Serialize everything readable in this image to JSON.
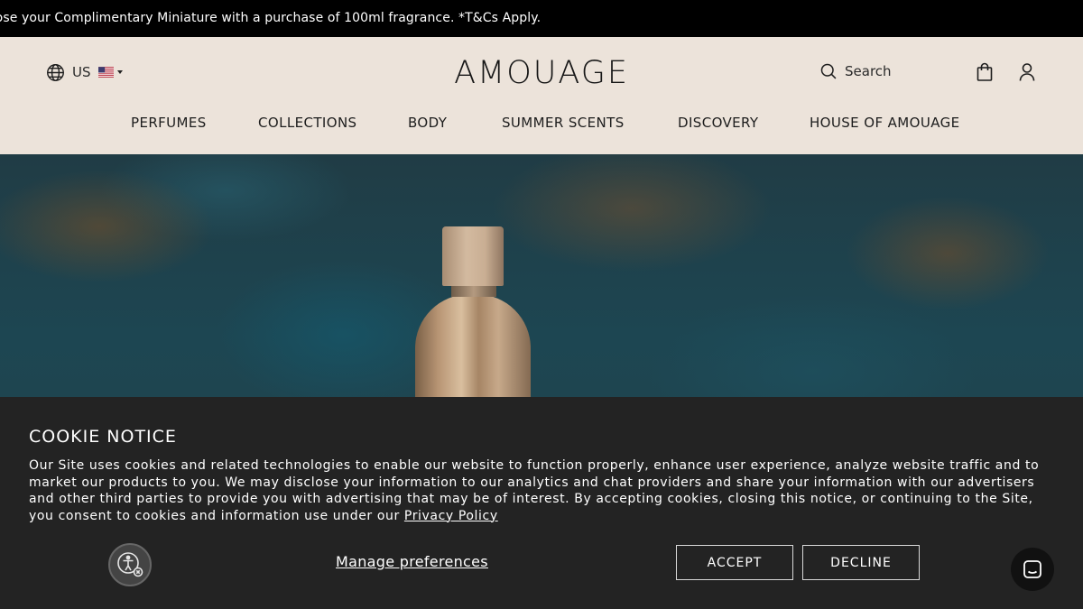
{
  "announcement": {
    "text": "oose your Complimentary Miniature with a purchase of 100ml fragrance. *T&Cs Apply."
  },
  "header": {
    "locale": {
      "code": "US",
      "icon": "globe-icon",
      "flag": "us-flag-icon"
    },
    "logo": "AMOUAGE",
    "search_label": "Search",
    "icons": [
      "search-icon",
      "shopping-bag-icon",
      "user-icon"
    ]
  },
  "nav": {
    "items": [
      {
        "label": "PERFUMES"
      },
      {
        "label": "COLLECTIONS"
      },
      {
        "label": "BODY"
      },
      {
        "label": "SUMMER SCENTS"
      },
      {
        "label": "DISCOVERY"
      },
      {
        "label": "HOUSE OF AMOUAGE"
      }
    ]
  },
  "cookie": {
    "title": "COOKIE NOTICE",
    "body": "Our Site uses cookies and related technologies to enable our website to function properly, enhance user experience, analyze website traffic and to market our products to you. We may disclose your information to our analytics and chat providers and share your information with our advertisers and other third parties to provide you with advertising that may be of interest. By accepting cookies, closing this notice, or continuing to the Site, you consent to cookies and information use under our",
    "policy_link": "Privacy Policy",
    "manage_label": "Manage preferences",
    "accept_label": "ACCEPT",
    "decline_label": "DECLINE"
  },
  "colors": {
    "announcement_bg": "#000000",
    "header_bg": "#ece3da",
    "cookie_bg": "#232323"
  }
}
